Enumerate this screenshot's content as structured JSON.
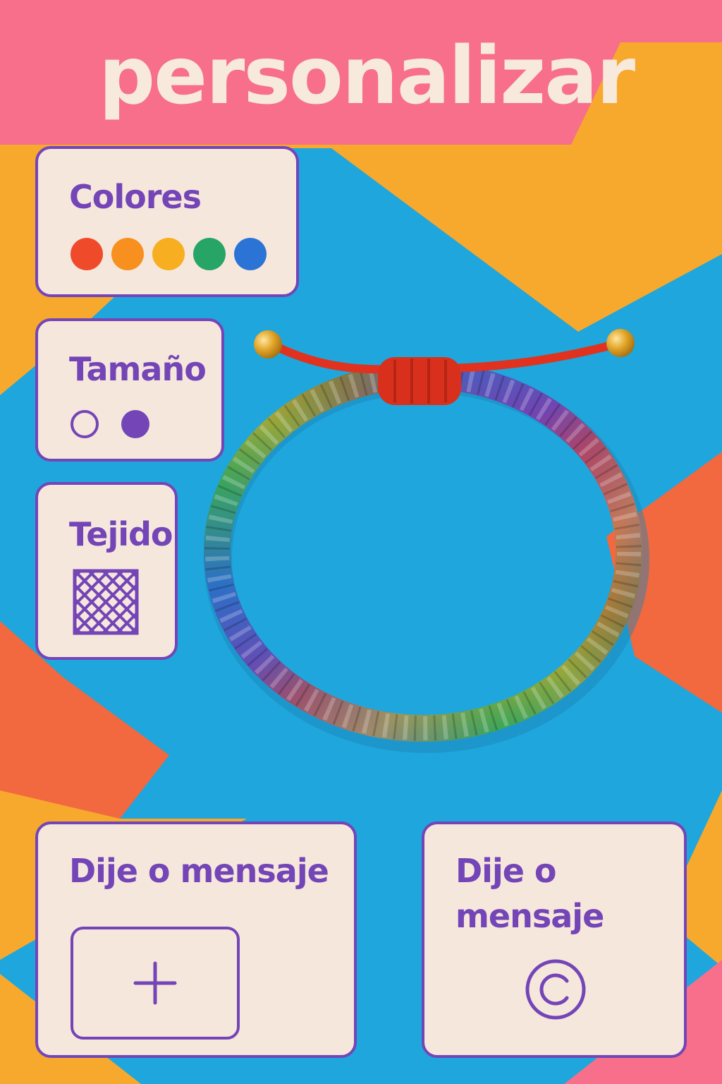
{
  "header": {
    "title": "personalizar"
  },
  "colors_card": {
    "title": "Colores",
    "swatches": [
      {
        "name": "red",
        "color": "#ef4b2a"
      },
      {
        "name": "orange",
        "color": "#f7901e"
      },
      {
        "name": "yellow",
        "color": "#f7ae20"
      },
      {
        "name": "green",
        "color": "#27a567"
      },
      {
        "name": "blue",
        "color": "#2b74d6"
      }
    ]
  },
  "size_card": {
    "title": "Tamaño",
    "options": [
      "small-empty",
      "large-filled"
    ]
  },
  "weave_card": {
    "title": "Tejido",
    "icon": "crosshatch-weave-icon"
  },
  "charm_card_left": {
    "title": "Dije o mensaje",
    "icon": "plus-icon"
  },
  "charm_card_right": {
    "title_line1": "Dije o",
    "title_line2": "mensaje",
    "icon": "copyright-icon"
  },
  "theme": {
    "accent": "#7445b7",
    "card_bg": "#f6e7dc",
    "bg_blue": "#1fa6dc",
    "bg_pink": "#f76f8a",
    "bg_orange": "#f7a92e",
    "bg_coral": "#f2683f"
  }
}
